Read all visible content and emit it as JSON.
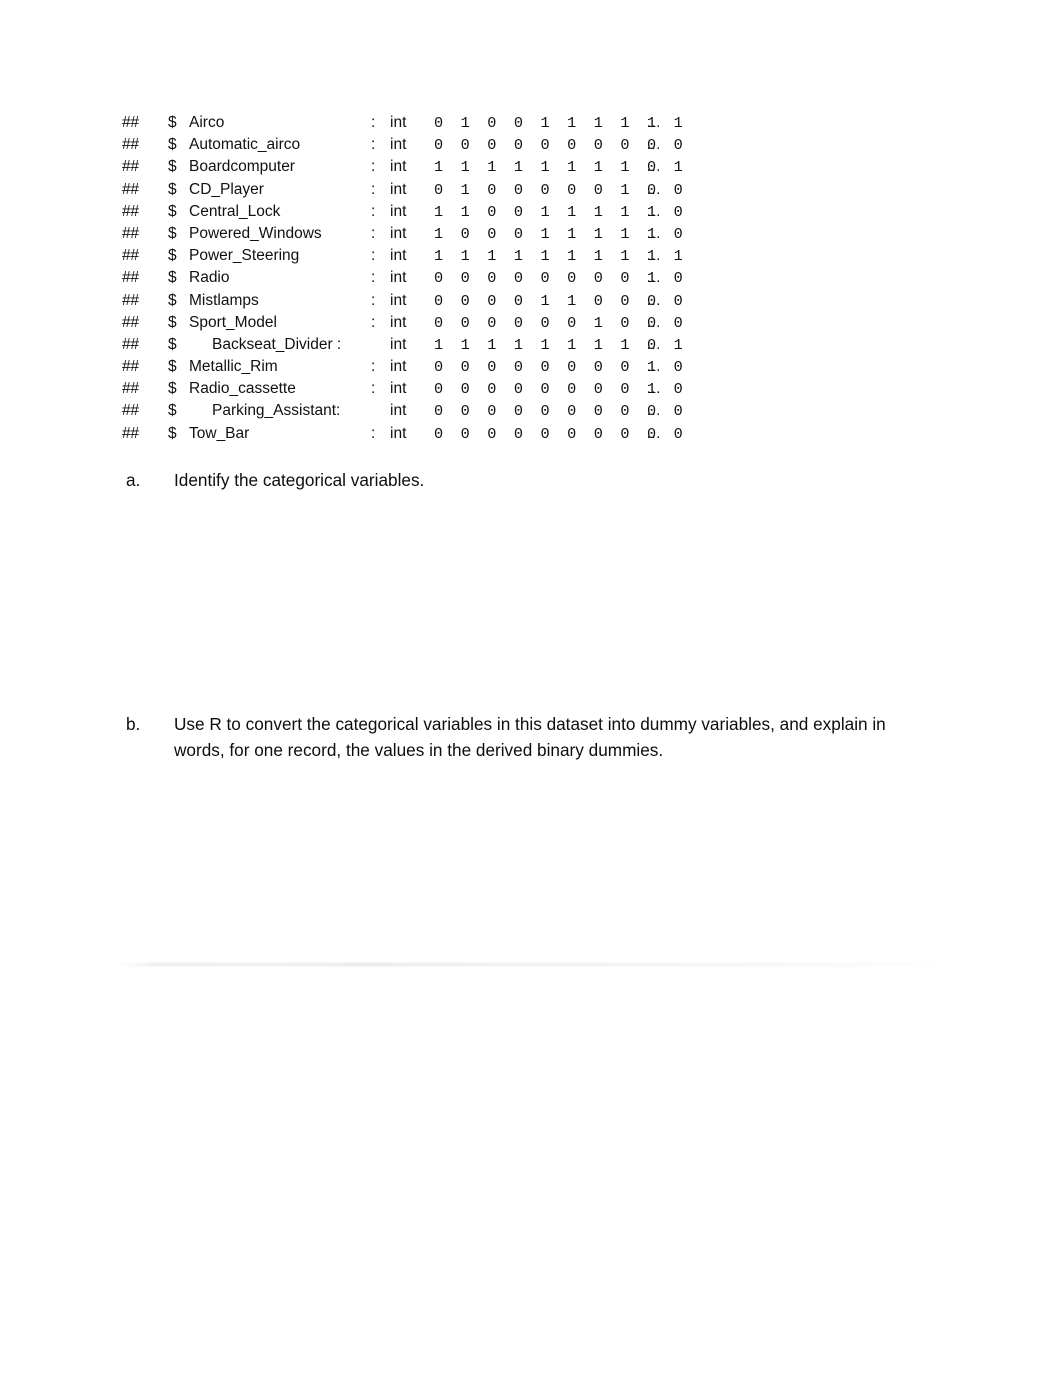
{
  "document": {
    "code_block": {
      "prefix": "##",
      "sigil": "$",
      "colon": ":",
      "type_label": "int",
      "ellipsis": "…",
      "lines": [
        {
          "name": "Airco",
          "type": "int",
          "values": "0 1 0 0 1 1 1 1 1 1",
          "indent": false,
          "inline_colon": false
        },
        {
          "name": "Automatic_airco",
          "type": "int",
          "values": "0 0 0 0 0 0 0 0 0 0",
          "indent": false,
          "inline_colon": false
        },
        {
          "name": "Boardcomputer",
          "type": "int",
          "values": "1 1 1 1 1 1 1 1 0 1",
          "indent": false,
          "inline_colon": false
        },
        {
          "name": "CD_Player",
          "type": "int",
          "values": "0 1 0 0 0 0 0 1 0 0",
          "indent": false,
          "inline_colon": false
        },
        {
          "name": "Central_Lock",
          "type": "int",
          "values": "1 1 0 0 1 1 1 1 1 0",
          "indent": false,
          "inline_colon": false
        },
        {
          "name": "Powered_Windows",
          "type": "int",
          "values": "1 0 0 0 1 1 1 1 1 0",
          "indent": false,
          "inline_colon": false
        },
        {
          "name": "Power_Steering",
          "type": "int",
          "values": "1 1 1 1 1 1 1 1 1 1",
          "indent": false,
          "inline_colon": false
        },
        {
          "name": "Radio",
          "type": "int",
          "values": "0 0 0 0 0 0 0 0 1 0",
          "indent": false,
          "inline_colon": false
        },
        {
          "name": "Mistlamps",
          "type": "int",
          "values": "0 0 0 0 1 1 0 0 0 0",
          "indent": false,
          "inline_colon": false
        },
        {
          "name": "Sport_Model",
          "type": "int",
          "values": "0 0 0 0 0 0 1 0 0 0",
          "indent": false,
          "inline_colon": false
        },
        {
          "name": "Backseat_Divider :",
          "type": "int",
          "values": "1 1 1 1 1 1 1 1 0 1",
          "indent": true,
          "inline_colon": true
        },
        {
          "name": "Metallic_Rim",
          "type": "int",
          "values": "0 0 0 0 0 0 0 0 1 0",
          "indent": false,
          "inline_colon": false
        },
        {
          "name": "Radio_cassette",
          "type": "int",
          "values": "0 0 0 0 0 0 0 0 1 0",
          "indent": false,
          "inline_colon": false
        },
        {
          "name": "Parking_Assistant:",
          "type": "int",
          "values": "0 0 0 0 0 0 0 0 0 0",
          "indent": true,
          "inline_colon": true
        },
        {
          "name": "Tow_Bar",
          "type": "int",
          "values": "0 0 0 0 0 0 0 0 0 0",
          "indent": false,
          "inline_colon": false
        }
      ]
    },
    "questions": [
      {
        "marker": "a.",
        "text": "Identify the categorical variables."
      },
      {
        "marker": "b.",
        "text": "Use R to convert the categorical variables in this dataset into dummy variables, and explain in words, for one record, the values in the derived binary dummies."
      }
    ]
  }
}
